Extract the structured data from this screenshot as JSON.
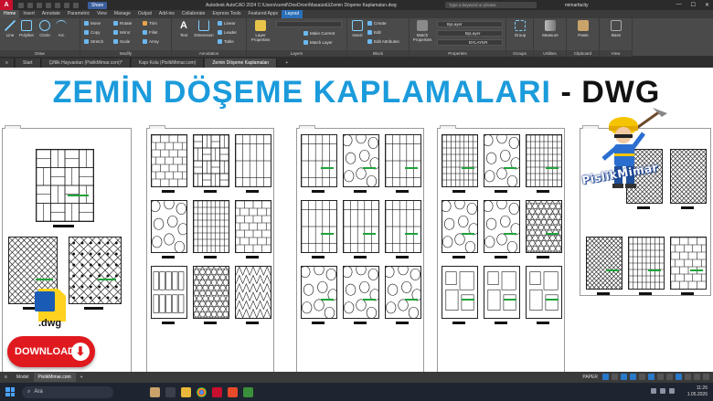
{
  "titlebar": {
    "logo": "A",
    "share": "Share",
    "title": "Autodesk AutoCAD 2024   C:\\Users\\cemil\\OneDrive\\Masaüstü\\Zemin Döşeme Kaplamaları.dwg",
    "search_placeholder": "Type a keyword or phrase",
    "user": "mimarfacity",
    "min": "—",
    "max": "☐",
    "close": "✕"
  },
  "ribbon_tabs": [
    "Home",
    "Insert",
    "Annotate",
    "Parametric",
    "View",
    "Manage",
    "Output",
    "Add-ins",
    "Collaborate",
    "Express Tools",
    "Featured Apps",
    "Layout"
  ],
  "ribbon": {
    "draw": {
      "title": "Draw",
      "line": "Line",
      "polyline": "Polyline",
      "circle": "Circle",
      "arc": "Arc"
    },
    "modify": {
      "title": "Modify",
      "move": "Move",
      "rotate": "Rotate",
      "trim": "Trim",
      "copy": "Copy",
      "mirror": "Mirror",
      "fillet": "Fillet",
      "stretch": "Stretch",
      "scale": "Scale",
      "array": "Array"
    },
    "annotation": {
      "title": "Annotation",
      "text": "Text",
      "dimension": "Dimension",
      "linear": "Linear",
      "leader": "Leader",
      "table": "Table"
    },
    "layers": {
      "title": "Layers",
      "layer_properties": "Layer Properties",
      "make_current": "Make Current",
      "match_layer": "Match Layer"
    },
    "block": {
      "title": "Block",
      "insert": "Insert",
      "create": "Create",
      "edit": "Edit",
      "edit_attributes": "Edit Attributes"
    },
    "properties": {
      "title": "Properties",
      "match_properties": "Match Properties",
      "bylayer1": "ByLayer",
      "bylayer2": "ByLayer",
      "bylayer3": "BYLAYER"
    },
    "groups": {
      "title": "Groups",
      "group": "Group"
    },
    "utilities": {
      "title": "Utilities",
      "measure": "Measure"
    },
    "clipboard": {
      "title": "Clipboard",
      "paste": "Paste"
    },
    "view": {
      "title": "View",
      "base": "Base"
    }
  },
  "file_tabs": [
    {
      "label": "Start"
    },
    {
      "label": "Çiftlik Hayvanları (PislikMimar.com)*"
    },
    {
      "label": "Kapı Kolu (PislikMimar.com)"
    },
    {
      "label": "Zemin Döşeme Kaplamaları"
    }
  ],
  "banner": {
    "title_blue": "ZEMİN DÖŞEME KAPLAMALARI",
    "title_dark": " - DWG"
  },
  "dwg_icon": {
    "label": ".dwg"
  },
  "download": {
    "label": "DOWNLOAD",
    "icon": "⬇"
  },
  "watermark": "PislikMimar",
  "layout_tabs": [
    "Model",
    "PislikMimar.com"
  ],
  "status": {
    "paper": "PAPER"
  },
  "taskbar": {
    "search": "Ara",
    "time": "11:26",
    "date": "1.05.2026"
  }
}
